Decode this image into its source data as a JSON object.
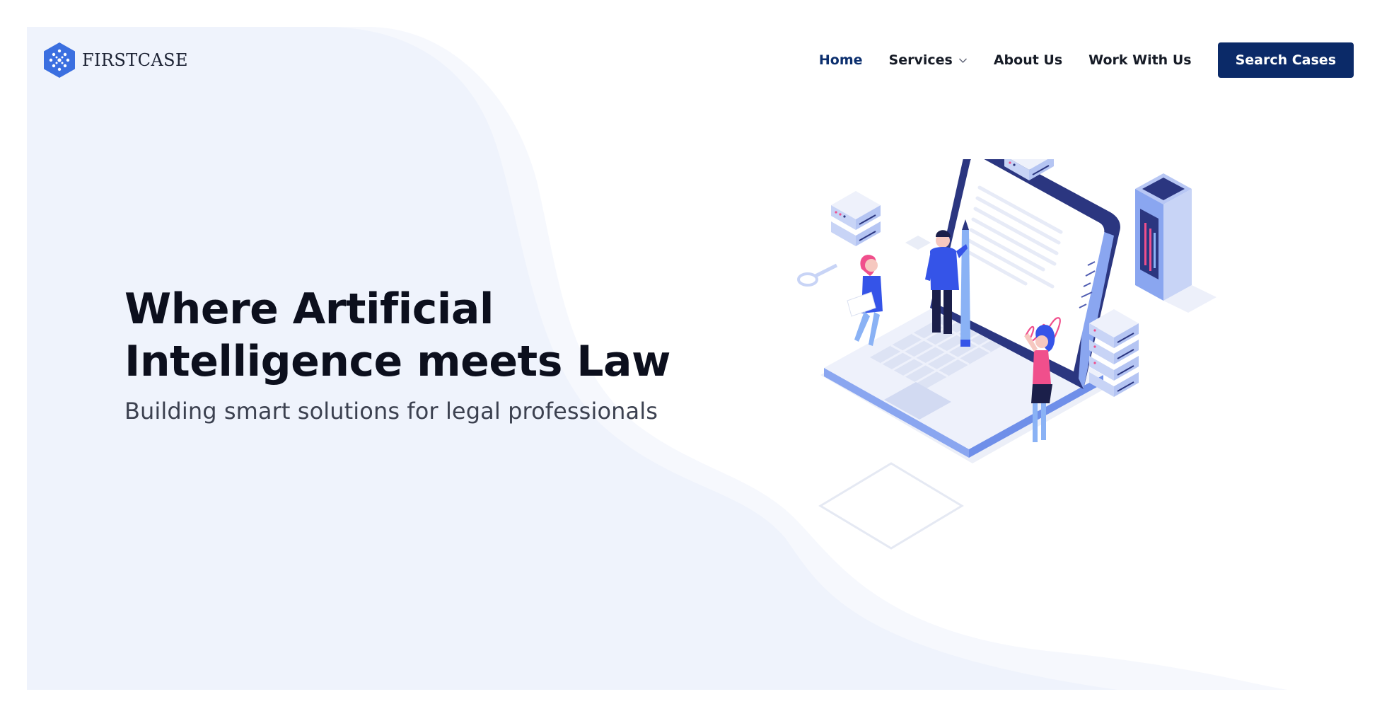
{
  "brand": {
    "name_part1": "FIRST",
    "name_part2": "CASE",
    "color": "#3b6fe0"
  },
  "nav": {
    "items": [
      {
        "label": "Home",
        "active": true
      },
      {
        "label": "Services",
        "has_dropdown": true
      },
      {
        "label": "About Us"
      },
      {
        "label": "Work With Us"
      }
    ],
    "cta_label": "Search Cases"
  },
  "hero": {
    "title_line1": "Where Artificial",
    "title_line2": "Intelligence meets Law",
    "subtitle": "Building smart solutions for legal professionals"
  },
  "colors": {
    "primary": "#0b2a68",
    "hero_bg": "#f0f4fc",
    "accent_blue": "#3554e8",
    "accent_pink": "#f04f8c"
  },
  "icons": [
    "firstcase-logo-icon",
    "chevron-down-icon"
  ]
}
